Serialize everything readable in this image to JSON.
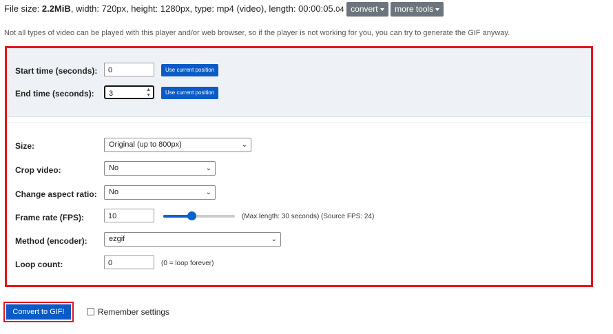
{
  "file_info": {
    "size_prefix": "File size: ",
    "size_value": "2.2MiB",
    "details": ", width: 720px, height: 1280px, type: mp4 (video), length: 00:00:05.",
    "length_fraction": "04",
    "convert_label": "convert",
    "more_tools_label": "more tools"
  },
  "notice": "Not all types of video can be played with this player and/or web browser, so if the player is not working for you, you can try to generate the GIF anyway.",
  "form": {
    "start_time": {
      "label": "Start time (seconds):",
      "value": "0",
      "button": "Use current position"
    },
    "end_time": {
      "label": "End time (seconds):",
      "value": "3",
      "button": "Use current position"
    },
    "size": {
      "label": "Size:",
      "value": "Original (up to 800px)"
    },
    "crop": {
      "label": "Crop video:",
      "value": "No"
    },
    "aspect": {
      "label": "Change aspect ratio:",
      "value": "No"
    },
    "fps": {
      "label": "Frame rate (FPS):",
      "value": "10",
      "note": "(Max length: 30 seconds) (Source FPS: 24)",
      "slider_fraction": 0.4
    },
    "method": {
      "label": "Method (encoder):",
      "value": "ezgif"
    },
    "loop": {
      "label": "Loop count:",
      "value": "0",
      "note": "(0 = loop forever)"
    }
  },
  "actions": {
    "convert_button": "Convert to GIF!",
    "remember_label": "Remember settings",
    "remember_checked": false
  },
  "colors": {
    "accent_blue": "#0a5bc5",
    "highlight_red": "#e3141b",
    "dropdown_gray": "#6c757d"
  }
}
